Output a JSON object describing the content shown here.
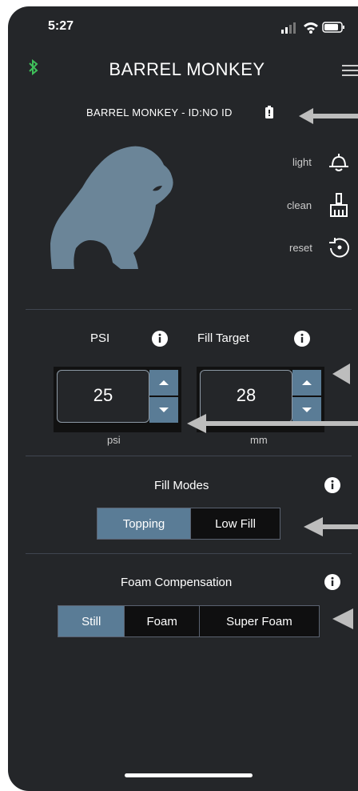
{
  "status": {
    "time": "5:27"
  },
  "header": {
    "title": "BARREL MONKEY"
  },
  "device": {
    "label": "BARREL MONKEY - ID:NO ID"
  },
  "actions": {
    "light": "light",
    "clean": "clean",
    "reset": "reset"
  },
  "psi": {
    "label": "PSI",
    "value": "25",
    "unit": "psi"
  },
  "fill_target": {
    "label": "Fill Target",
    "value": "28",
    "unit": "mm"
  },
  "fill_modes": {
    "label": "Fill Modes",
    "options": [
      "Topping",
      "Low Fill"
    ],
    "selected": "Topping"
  },
  "foam": {
    "label": "Foam Compensation",
    "options": [
      "Still",
      "Foam",
      "Super Foam"
    ],
    "selected": "Still"
  },
  "colors": {
    "background": "#242629",
    "accent": "#5a7c96",
    "bluetooth": "#3fbf5a",
    "gorilla": "#6b8598"
  },
  "icons": [
    "bluetooth-icon",
    "menu-icon",
    "battery-icon",
    "lamp-icon",
    "broom-icon",
    "reset-icon",
    "info-icon",
    "chevron-up-icon",
    "chevron-down-icon",
    "gorilla-logo"
  ]
}
